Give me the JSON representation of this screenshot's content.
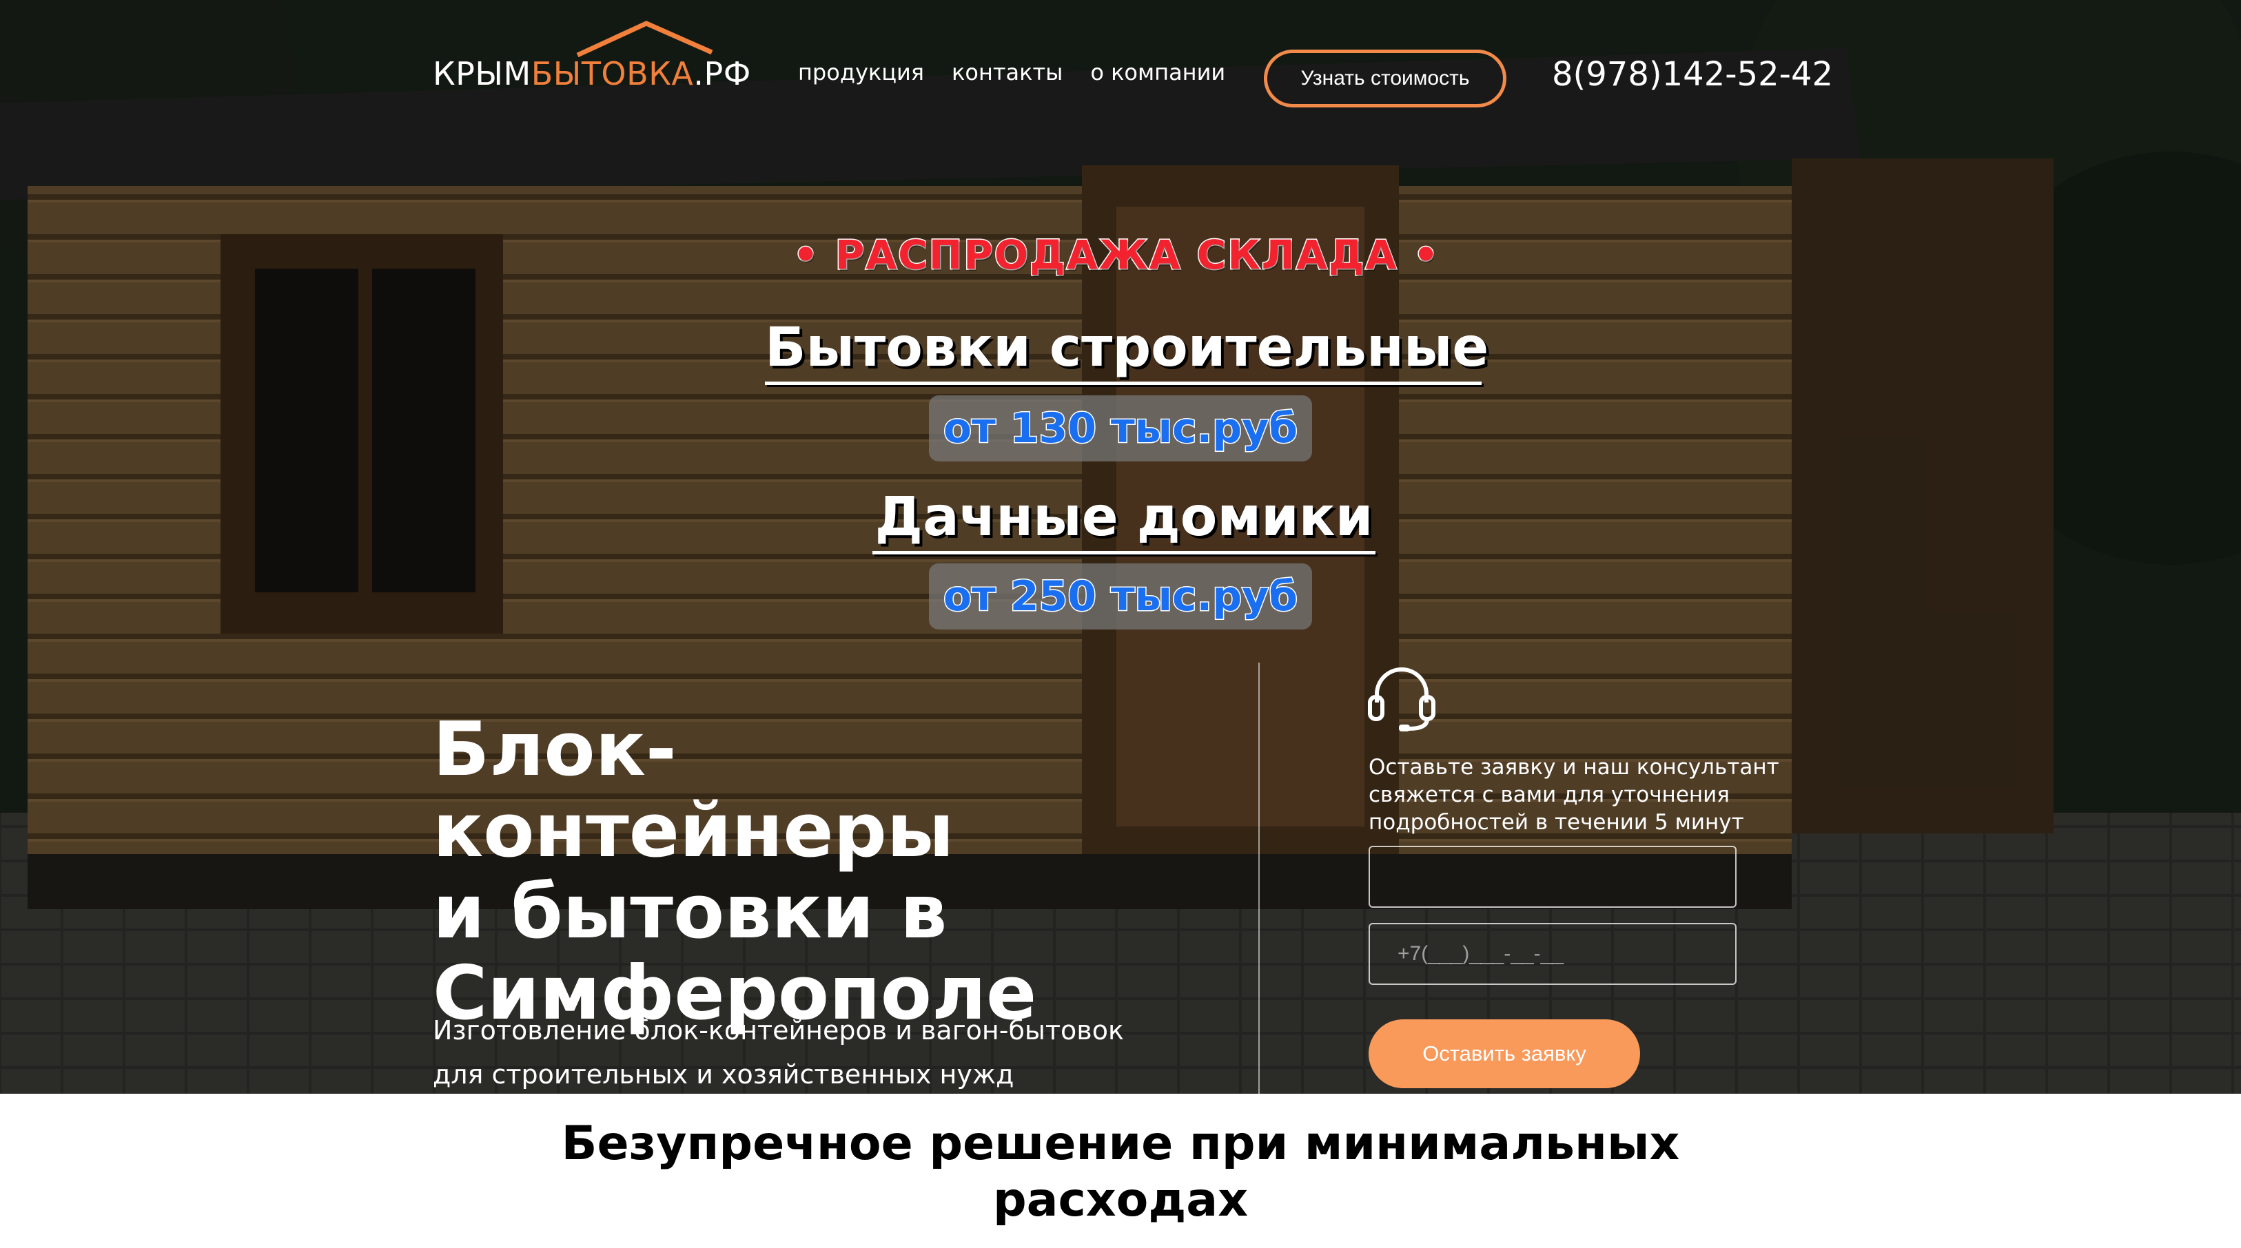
{
  "header": {
    "logo": {
      "part1": "КРЫМ",
      "part2": "БЫТОВКА",
      "part3": ".РФ"
    },
    "nav": [
      {
        "label": "продукция"
      },
      {
        "label": "контакты"
      },
      {
        "label": "о компании"
      }
    ],
    "cta_label": "Узнать стоимость",
    "phone": "8(978)142-52-42"
  },
  "promo": {
    "sale": "• РАСПРОДАЖА СКЛАДА •",
    "item1_title": "Бытовки строительные",
    "item1_price": "от 130 тыс.руб",
    "item2_title": "Дачные домики",
    "item2_price": "от 250 тыс.руб"
  },
  "main": {
    "title_line1": "Блок-контейнеры",
    "title_line2": "и бытовки в",
    "title_line3": "Симферополе",
    "sub_line1": "Изготовление блок-контейнеров и вагон-бытовок",
    "sub_line2": "для строительных и хозяйственных нужд"
  },
  "form": {
    "text_line1": "Оставьте заявку и наш консультант",
    "text_line2": "свяжется с вами для уточнения",
    "text_line3": "подробностей в течении 5 минут",
    "name_value": "",
    "phone_placeholder": "+7(___)___-__-__",
    "submit_label": "Оставить заявку"
  },
  "bottom": {
    "title_line1": "Безупречное решение при минимальных",
    "title_line2": "расходах"
  },
  "colors": {
    "accent": "#f0803c",
    "button": "#f9995a",
    "sale_red": "#f2232f",
    "price_blue": "#1a6ff0"
  },
  "icons": [
    "roof-icon",
    "headset-icon"
  ]
}
